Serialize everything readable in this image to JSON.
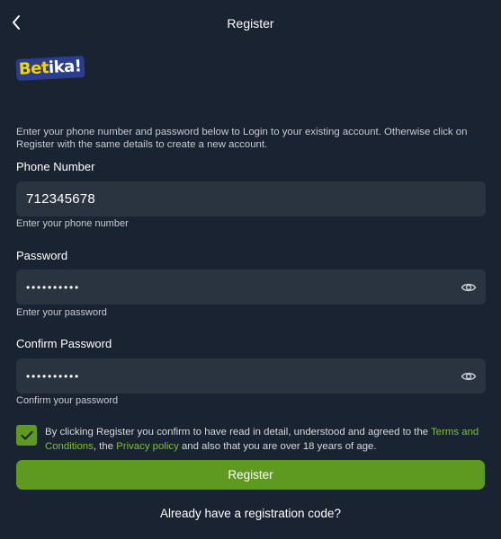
{
  "header": {
    "title": "Register",
    "back_icon": "chevron-left-icon"
  },
  "logo": {
    "part1": "Bet",
    "part2": "ika!"
  },
  "intro_text": "Enter your phone number and password below to Login to your existing account. Otherwise click on Register with the same details to create a new account.",
  "phone": {
    "label": "Phone Number",
    "value": "712345678",
    "helper": "Enter your phone number"
  },
  "password": {
    "label": "Password",
    "value": "••••••••••",
    "helper": "Enter your password",
    "toggle_icon": "eye-icon"
  },
  "confirm_password": {
    "label": "Confirm Password",
    "value": "••••••••••",
    "helper": "Confirm your password",
    "toggle_icon": "eye-icon"
  },
  "consent": {
    "checked": true,
    "text_1": "By clicking Register you confirm to have read in detail, understood and agreed to the ",
    "terms_link": "Terms and Conditions",
    "text_2": ", the ",
    "privacy_link": "Privacy policy",
    "text_3": " and also that you are over 18 years of age."
  },
  "register_button": "Register",
  "registration_code_link": "Already have a registration code?",
  "colors": {
    "background": "#1a2331",
    "field": "#2a3441",
    "accent": "#5e9a1f",
    "link": "#7cbf33",
    "logo_yellow": "#f5d400"
  }
}
